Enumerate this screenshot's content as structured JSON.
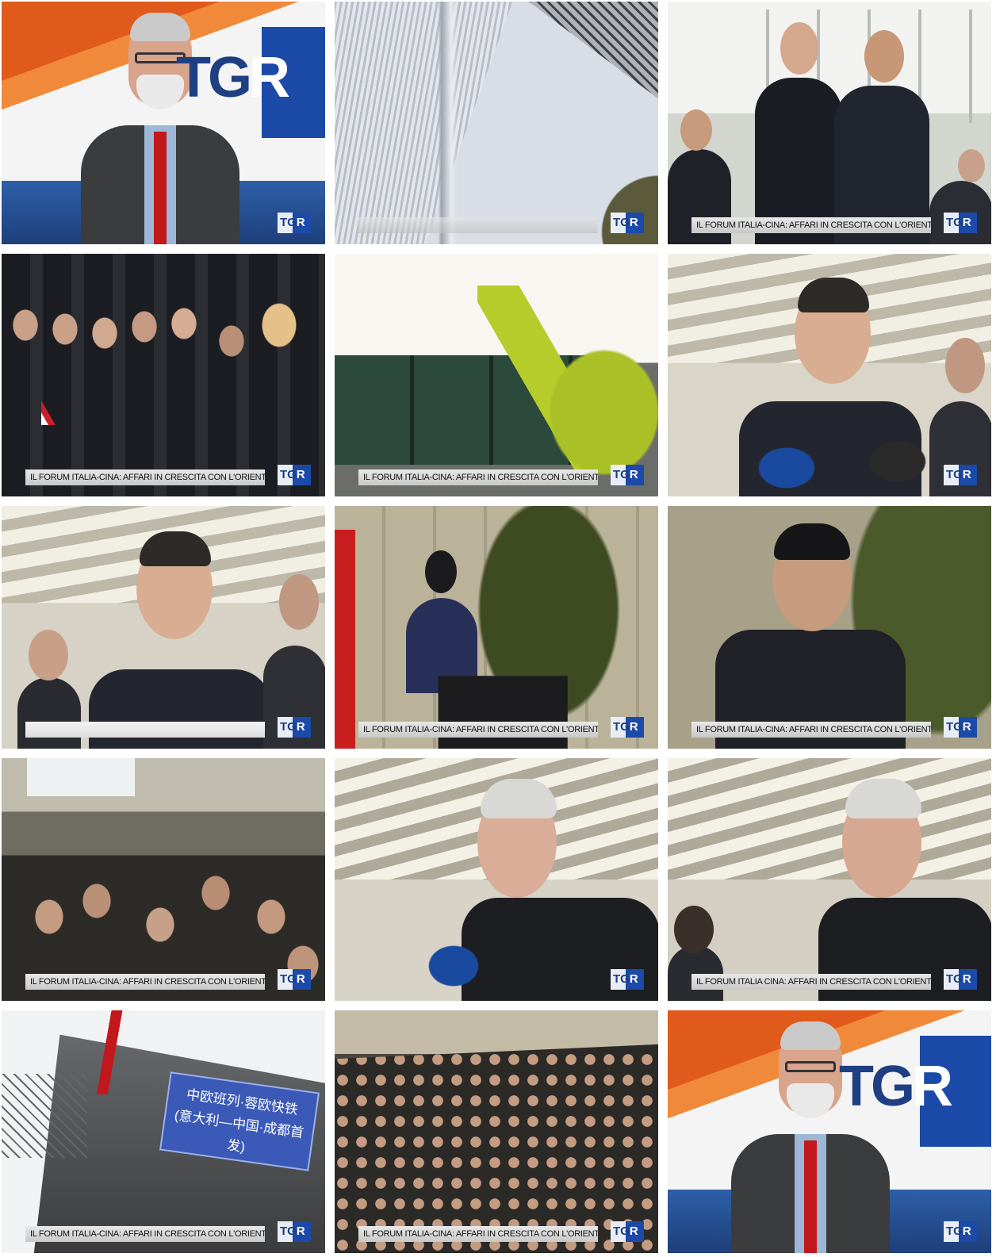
{
  "logo": {
    "main": "TG",
    "accent": "R"
  },
  "frames": [
    {
      "id": 1,
      "scene": "studio-anchor",
      "caption": null,
      "bug": true
    },
    {
      "id": 2,
      "scene": "building-abstract",
      "caption": "",
      "caption_style": "blurred",
      "bug": true
    },
    {
      "id": 3,
      "scene": "handshake",
      "caption": "IL FORUM ITALIA-CINA: AFFARI IN CRESCITA CON L'ORIENTE",
      "bug": true
    },
    {
      "id": 4,
      "scene": "crowd-outdoor",
      "caption": "IL FORUM ITALIA-CINA: AFFARI IN CRESCITA CON L'ORIENTE",
      "bug": true
    },
    {
      "id": 5,
      "scene": "freight-train-crane",
      "caption": "IL FORUM ITALIA-CINA: AFFARI IN CRESCITA CON L'ORIENTE",
      "bug": true
    },
    {
      "id": 6,
      "scene": "interview-glasses",
      "caption": null,
      "bug": true
    },
    {
      "id": 7,
      "scene": "interview-glasses-2",
      "caption": "",
      "caption_style": "blank",
      "bug": true
    },
    {
      "id": 8,
      "scene": "podium-speaker",
      "caption": "IL FORUM ITALIA-CINA: AFFARI IN CRESCITA CON L'ORIENTE",
      "bug": true
    },
    {
      "id": 9,
      "scene": "speaker-microphone",
      "caption": "IL FORUM ITALIA-CINA: AFFARI IN CRESCITA CON L'ORIENTE",
      "bug": true
    },
    {
      "id": 10,
      "scene": "conference-room",
      "caption": "IL FORUM ITALIA-CINA: AFFARI IN CRESCITA CON L'ORIENTE",
      "bug": true
    },
    {
      "id": 11,
      "scene": "interview-grey-hair",
      "caption": null,
      "bug": true
    },
    {
      "id": 12,
      "scene": "interview-grey-hair-2",
      "caption": "IL FORUM ITALIA CINA: AFFARI IN CRESCITA CON L'ORIENTE",
      "bug": true
    },
    {
      "id": 13,
      "scene": "train-banner",
      "caption": "IL FORUM ITALIA-CINA: AFFARI IN CRESCITA CON L'ORIENTE",
      "bug": true,
      "banner": [
        "中欧班列·蓉欧快铁",
        "(意大利—中国·成都首发)"
      ]
    },
    {
      "id": 14,
      "scene": "audience-hall",
      "caption": "IL FORUM ITALIA-CINA: AFFARI IN CRESCITA CON L'ORIENTE",
      "bug": true
    },
    {
      "id": 15,
      "scene": "studio-anchor",
      "caption": null,
      "bug": true
    }
  ]
}
